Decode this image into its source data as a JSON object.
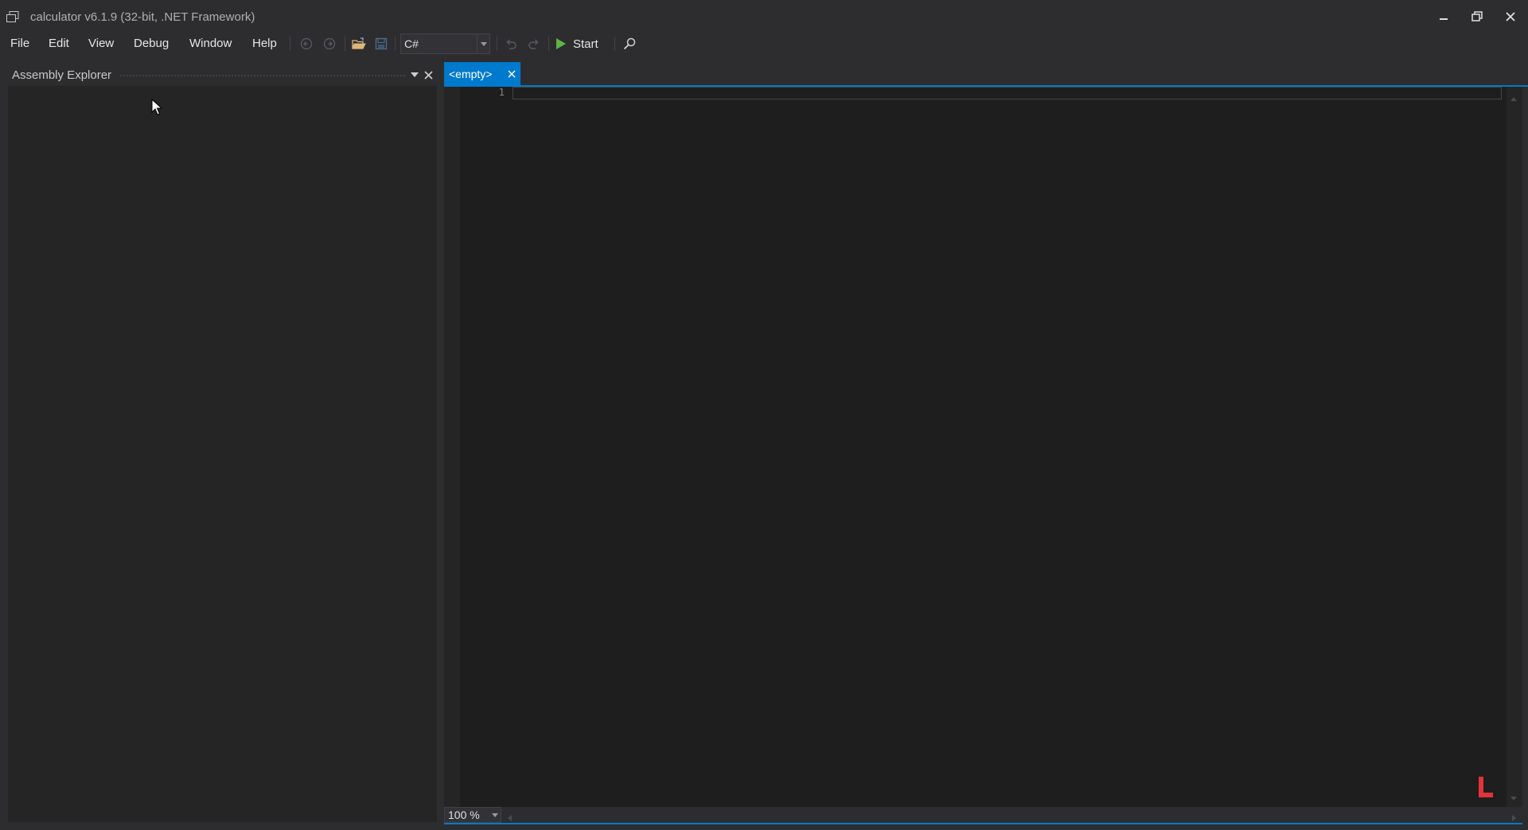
{
  "window": {
    "title": "calculator v6.1.9 (32-bit, .NET Framework)",
    "icons": [
      "app-icon",
      "minimize-icon",
      "restore-icon",
      "close-icon"
    ]
  },
  "menu": {
    "items": [
      "File",
      "Edit",
      "View",
      "Debug",
      "Window",
      "Help"
    ]
  },
  "toolbar": {
    "language": "C#",
    "start_label": "Start",
    "icons": [
      "back-icon",
      "forward-icon",
      "open-folder-icon",
      "save-icon",
      "undo-icon",
      "redo-icon",
      "play-icon",
      "search-icon"
    ]
  },
  "explorer": {
    "title": "Assembly Explorer"
  },
  "editor": {
    "tab_label": "<empty>",
    "line_numbers": [
      "1"
    ],
    "zoom": "100 %"
  },
  "colors": {
    "accent": "#007acc",
    "start_play": "#5db547",
    "brand_mark": "#e2323a",
    "background": "#2d2d30",
    "editor_bg": "#1e1e1e"
  }
}
